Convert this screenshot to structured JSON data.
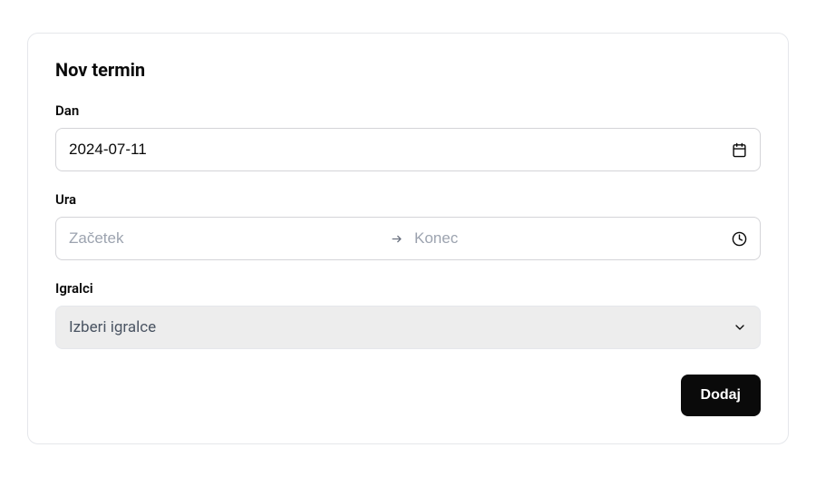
{
  "card": {
    "title": "Nov termin"
  },
  "fields": {
    "day": {
      "label": "Dan",
      "value": "2024-07-11"
    },
    "time": {
      "label": "Ura",
      "start_placeholder": "Začetek",
      "end_placeholder": "Konec"
    },
    "players": {
      "label": "Igralci",
      "placeholder": "Izberi igralce"
    }
  },
  "actions": {
    "submit": "Dodaj"
  }
}
